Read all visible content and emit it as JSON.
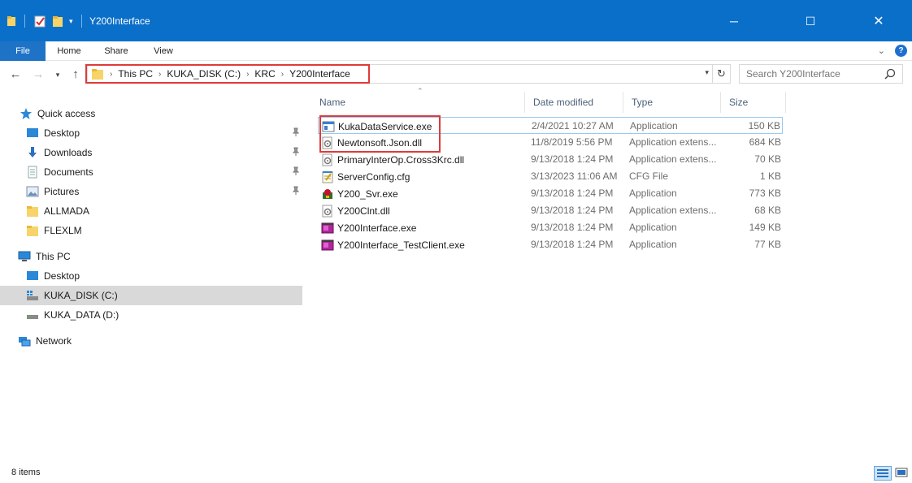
{
  "window": {
    "title": "Y200Interface",
    "controls": {
      "minimize": "─",
      "maximize": "☐",
      "close": "✕"
    }
  },
  "ribbon": {
    "tabs": [
      "File",
      "Home",
      "Share",
      "View"
    ]
  },
  "address": {
    "crumbs": [
      "This PC",
      "KUKA_DISK (C:)",
      "KRC",
      "Y200Interface"
    ],
    "search_placeholder": "Search Y200Interface"
  },
  "nav": {
    "quick_access": "Quick access",
    "quick_items": [
      "Desktop",
      "Downloads",
      "Documents",
      "Pictures",
      "ALLMADA",
      "FLEXLM"
    ],
    "this_pc": "This PC",
    "pc_items": [
      "Desktop",
      "KUKA_DISK (C:)",
      "KUKA_DATA (D:)"
    ],
    "network": "Network"
  },
  "columns": {
    "name": "Name",
    "date": "Date modified",
    "type": "Type",
    "size": "Size"
  },
  "files": [
    {
      "name": "KukaDataService.exe",
      "date": "2/4/2021 10:27 AM",
      "type": "Application",
      "size": "150 KB",
      "icon": "exe-window-icon"
    },
    {
      "name": "Newtonsoft.Json.dll",
      "date": "11/8/2019 5:56 PM",
      "type": "Application extens...",
      "size": "684 KB",
      "icon": "dll-gear-icon"
    },
    {
      "name": "PrimaryInterOp.Cross3Krc.dll",
      "date": "9/13/2018 1:24 PM",
      "type": "Application extens...",
      "size": "70 KB",
      "icon": "dll-gear-icon"
    },
    {
      "name": "ServerConfig.cfg",
      "date": "3/13/2023 11:06 AM",
      "type": "CFG File",
      "size": "1 KB",
      "icon": "cfg-notepad-icon"
    },
    {
      "name": "Y200_Svr.exe",
      "date": "9/13/2018 1:24 PM",
      "type": "Application",
      "size": "773 KB",
      "icon": "svr-app-icon"
    },
    {
      "name": "Y200Clnt.dll",
      "date": "9/13/2018 1:24 PM",
      "type": "Application extens...",
      "size": "68 KB",
      "icon": "dll-gear-icon"
    },
    {
      "name": "Y200Interface.exe",
      "date": "9/13/2018 1:24 PM",
      "type": "Application",
      "size": "149 KB",
      "icon": "app-purple-icon"
    },
    {
      "name": "Y200Interface_TestClient.exe",
      "date": "9/13/2018 1:24 PM",
      "type": "Application",
      "size": "77 KB",
      "icon": "app-purple-icon"
    }
  ],
  "status": {
    "count": "8 items"
  },
  "colors": {
    "titlebar": "#0a6fc9",
    "file_tab": "#1f73c6",
    "highlight": "#e03a3a",
    "selected": "#d9d9d9"
  }
}
